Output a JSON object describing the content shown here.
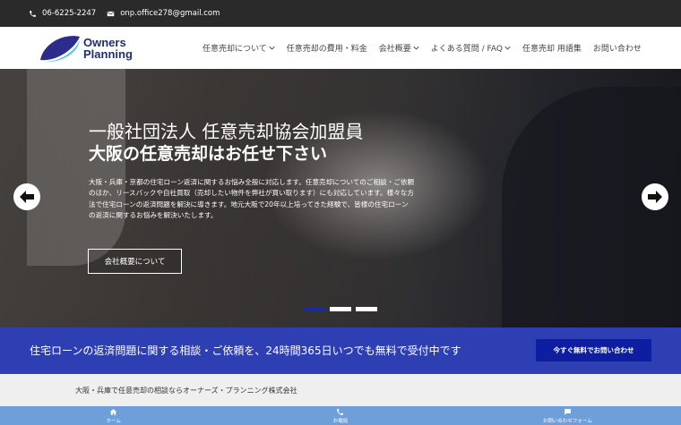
{
  "topbar": {
    "phone": "06-6225-2247",
    "email": "onp.office278@gmail.com",
    "phone_icon": "phone-icon",
    "email_icon": "envelope-icon"
  },
  "header": {
    "logo_line1": "Owners",
    "logo_line2": "Planning",
    "nav": [
      {
        "label": "任意売却について",
        "has_dropdown": true
      },
      {
        "label": "任意売却の費用・料金",
        "has_dropdown": false
      },
      {
        "label": "会社概要",
        "has_dropdown": true
      },
      {
        "label": "よくある質問 / FAQ",
        "has_dropdown": true
      },
      {
        "label": "任意売却 用語集",
        "has_dropdown": false
      },
      {
        "label": "お問い合わせ",
        "has_dropdown": false
      }
    ]
  },
  "hero": {
    "title_line1": "一般社団法人 任意売却協会加盟員",
    "title_line2": "大阪の任意売却はお任せ下さい",
    "description": "大阪・兵庫・京都の住宅ローン返済に関するお悩み全般に対応します。任意売却についてのご相談・ご依頼のほか、リースバックや自社買取（売却したい物件を弊社が買い取ります）にも対応しています。様々な方法で住宅ローンの返済問題を解決に導きます。地元大阪で20年以上培ってきた経験で、皆様の住宅ローンの返済に関するお悩みを解決いたします。",
    "button_label": "会社概要について",
    "slides_total": 3,
    "active_slide": 1
  },
  "cta": {
    "text": "住宅ローンの返済問題に関する相談・ご依頼を、24時間365日いつでも無料で受付中です",
    "button_label": "今すぐ無料でお問い合わせ"
  },
  "footer_strip": {
    "text": "大阪・兵庫で任意売却の相談ならオーナーズ・プランニング株式会社"
  },
  "bottom_nav": [
    {
      "label": "ホーム",
      "icon": "home-icon"
    },
    {
      "label": "お電話",
      "icon": "phone-icon"
    },
    {
      "label": "お問い合わせフォーム",
      "icon": "chat-icon"
    }
  ],
  "colors": {
    "topbar_bg": "#2a2a2a",
    "brand_navy": "#1f2f70",
    "cta_bg": "#2e3fb3",
    "cta_button": "#0d1ea0",
    "bottom_nav_bg": "#6f9fd8",
    "slide_active": "#1b2a9c"
  }
}
